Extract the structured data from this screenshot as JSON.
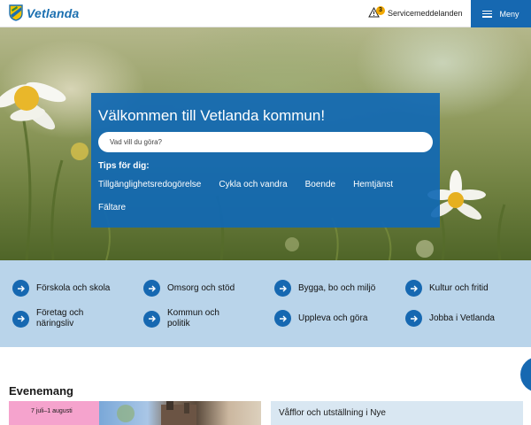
{
  "header": {
    "logo_text": "Vetlanda",
    "service_label": "Servicemeddelanden",
    "service_count": "3",
    "menu_label": "Meny"
  },
  "hero": {
    "title": "Välkommen till Vetlanda kommun!",
    "search_placeholder": "Vad vill du göra?",
    "tips_title": "Tips för dig:",
    "tips": [
      "Tillgänglighetsredogörelse",
      "Cykla och vandra",
      "Boende",
      "Hemtjänst",
      "Fältare"
    ]
  },
  "quick_links": [
    "Förskola och skola",
    "Omsorg och stöd",
    "Bygga, bo och miljö",
    "Kultur och fritid",
    "Företag och näringsliv",
    "Kommun och politik",
    "Uppleva och göra",
    "Jobba i Vetlanda"
  ],
  "events": {
    "title": "Evenemang",
    "card_date": "7 juli–1 augusti",
    "card_name": "Våfflor och utställning i Nye"
  },
  "colors": {
    "brand_blue": "#1668b1",
    "quick_bg": "#b9d4ea",
    "pink": "#f5a3cd",
    "warning": "#f2a900"
  }
}
